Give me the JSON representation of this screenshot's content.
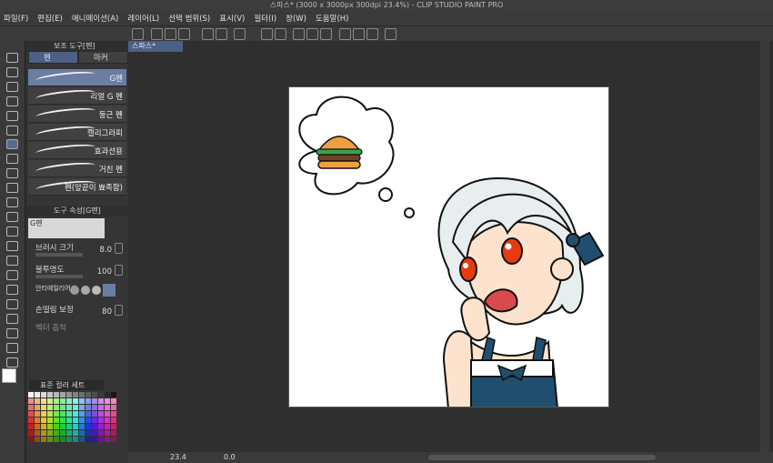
{
  "window": {
    "title": "스파스* (3000 x 3000px 300dpi 23.4%) - CLIP STUDIO PAINT PRO"
  },
  "menu": [
    "파일(F)",
    "편집(E)",
    "애니메이션(A)",
    "레이어(L)",
    "선택 범위(S)",
    "표시(V)",
    "필터(I)",
    "창(W)",
    "도움말(H)"
  ],
  "subtool_panel": {
    "title": "보조 도구[펜]",
    "tabs": [
      "펜",
      "마커"
    ],
    "brushes": [
      "G펜",
      "리얼 G 펜",
      "둥근 펜",
      "캘리그라피",
      "효과선용",
      "거친 펜",
      "펜(앞끝이 뾰족함)"
    ]
  },
  "tool_property": {
    "title": "도구 속성[G펜]",
    "preview_label": "G펜",
    "brush_size_label": "브러시 크기",
    "brush_size_value": "8.0",
    "opacity_label": "불투명도",
    "opacity_value": "100",
    "antialias_label": "안티에일리어싱",
    "stabilization_label": "손떨림 보정",
    "stabilization_value": "80",
    "vector_snap_label": "벡터 흡착"
  },
  "color_set": {
    "label": "표준 컬러 세트"
  },
  "document": {
    "tab_label": "스파스*"
  },
  "status": {
    "zoom": "23.4",
    "rotation": "0.0"
  },
  "colors": {
    "accent": "#4c5f87",
    "burger_bun": "#f0a040",
    "burger_lettuce": "#3aa34a",
    "burger_patty": "#6b4426",
    "eye": "#e83a10",
    "ribbon": "#1f4e6e",
    "hair": "#e8eef0"
  }
}
